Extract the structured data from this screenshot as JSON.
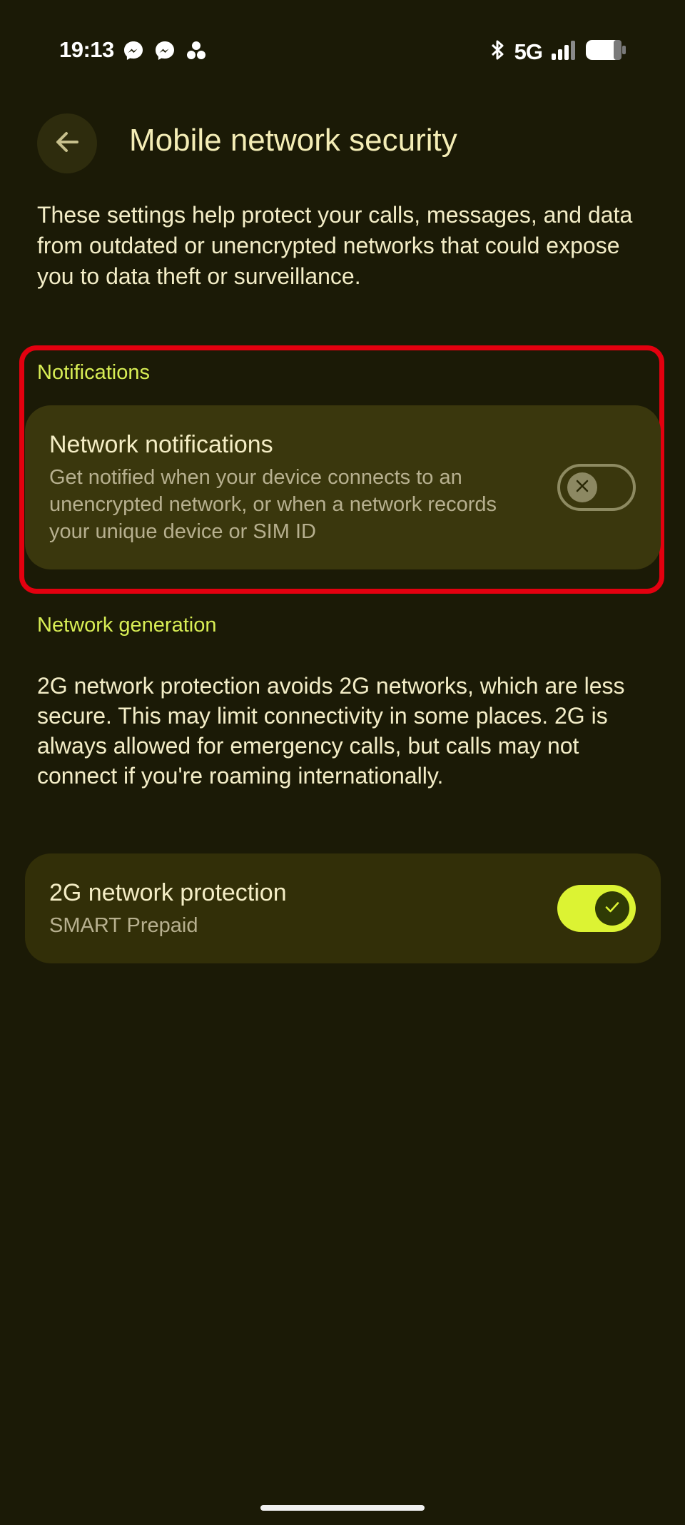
{
  "status_bar": {
    "time": "19:13",
    "network": "5G",
    "left_icons": [
      "messenger-icon",
      "messenger-icon",
      "app-icon"
    ],
    "right_icons": [
      "bluetooth-icon",
      "signal-icon",
      "battery-icon"
    ]
  },
  "header": {
    "title": "Mobile network security",
    "back_icon": "arrow-left-icon"
  },
  "intro": "These settings help protect your calls, messages, and data from outdated or unencrypted networks that could expose you to data theft or surveillance.",
  "notifications_section": {
    "header": "Notifications",
    "item": {
      "title": "Network notifications",
      "description": "Get notified when your device connects to an unencrypted network, or when a network records your unique device or SIM ID",
      "enabled": false
    }
  },
  "generation_section": {
    "header": "Network generation",
    "description": "2G network protection avoids 2G networks, which are less secure. This may limit connectivity in some places. 2G is always allowed for emergency calls, but calls may not connect if you're roaming internationally.",
    "item": {
      "title": "2G network protection",
      "subtitle": "SMART Prepaid",
      "enabled": true
    }
  },
  "colors": {
    "background": "#1b1a06",
    "accent": "#dcf333",
    "section_header": "#d8ee55",
    "card": "#3a370d",
    "highlight": "#e3000f"
  }
}
